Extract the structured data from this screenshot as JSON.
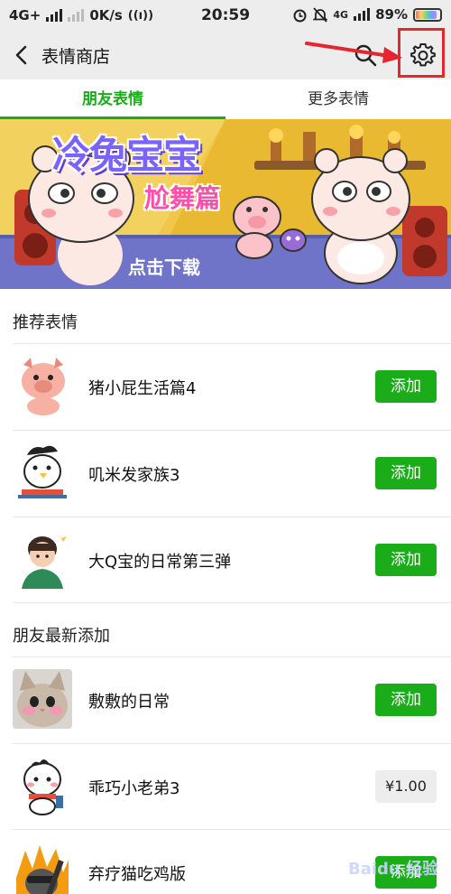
{
  "status_bar": {
    "network": "4G+",
    "speed": "0K/s",
    "time": "20:59",
    "network2": "4G",
    "battery": "89%"
  },
  "header": {
    "title": "表情商店",
    "icons": [
      "back-icon",
      "search-icon",
      "gear-icon"
    ]
  },
  "tabs": [
    {
      "label": "朋友表情",
      "active": true
    },
    {
      "label": "更多表情",
      "active": false
    }
  ],
  "banner": {
    "title": "冷兔宝宝",
    "subtitle": "尬舞篇",
    "cta": "点击下载"
  },
  "sections": [
    {
      "title": "推荐表情",
      "items": [
        {
          "name": "猪小屁生活篇4",
          "action": "添加"
        },
        {
          "name": "叽米发家族3",
          "action": "添加"
        },
        {
          "name": "大Q宝的日常第三弹",
          "action": "添加"
        }
      ]
    },
    {
      "title": "朋友最新添加",
      "items": [
        {
          "name": "敷敷的日常",
          "action": "添加"
        },
        {
          "name": "乖巧小老弟3",
          "action": "¥1.00"
        },
        {
          "name": "弃疗猫吃鸡版",
          "action": "添加"
        }
      ]
    }
  ],
  "watermark": "Baidu 经验",
  "colors": {
    "accent": "#1aad19",
    "highlight": "#e3262f",
    "header_bg": "#ededed"
  }
}
